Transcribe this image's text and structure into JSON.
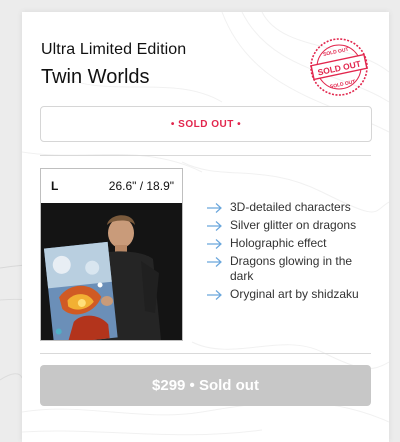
{
  "product": {
    "edition": "Ultra Limited Edition",
    "title": "Twin Worlds",
    "stamp_text": "SOLD OUT",
    "status": "• SOLD OUT •"
  },
  "variant": {
    "size": "L",
    "dimensions": "26.6\" / 18.9\""
  },
  "features": [
    "3D-detailed characters",
    "Silver glitter on dragons",
    "Holographic effect",
    "Dragons glowing in the dark",
    "Oryginal art by shidzaku"
  ],
  "buy_button": {
    "label": "$299 • Sold out"
  },
  "colors": {
    "accent": "#e2264d",
    "arrow": "#6aa6dc",
    "button_disabled": "#c7c7c7"
  }
}
